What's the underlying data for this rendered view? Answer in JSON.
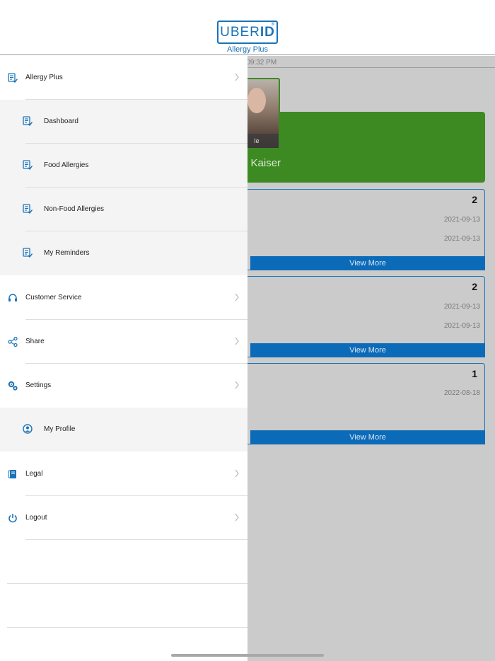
{
  "header": {
    "logo_left": "UBER",
    "logo_right": "ID",
    "logo_mark": "®",
    "subtitle": "Allergy Plus"
  },
  "background": {
    "timestamp": "3 09:32 PM",
    "photo_caption": "le",
    "name_fragment": "n Kaiser",
    "cards": [
      {
        "count": "2",
        "dates": [
          "2021-09-13",
          "2021-09-13"
        ],
        "button": "View More"
      },
      {
        "count": "2",
        "dates": [
          "2021-09-13",
          "2021-09-13"
        ],
        "button": "View More"
      },
      {
        "count": "1",
        "dates": [
          "2022-08-18"
        ],
        "button": "View More"
      }
    ],
    "colors": {
      "overlay": "#cbcbcb",
      "green": "#3d8a23",
      "blue": "#0c6bb8"
    }
  },
  "menu": {
    "items": [
      {
        "label": "Allergy Plus",
        "icon": "checklist-icon",
        "chevron": true
      },
      {
        "label": "Dashboard",
        "icon": "checklist-icon",
        "sub": true
      },
      {
        "label": "Food Allergies",
        "icon": "checklist-icon",
        "sub": true
      },
      {
        "label": "Non-Food Allergies",
        "icon": "checklist-icon",
        "sub": true
      },
      {
        "label": "My Reminders",
        "icon": "checklist-icon",
        "sub": true
      },
      {
        "label": "Customer Service",
        "icon": "headset-icon",
        "chevron": true
      },
      {
        "label": "Share",
        "icon": "share-icon",
        "chevron": true
      },
      {
        "label": "Settings",
        "icon": "gears-icon",
        "chevron": true
      },
      {
        "label": "My Profile",
        "icon": "profile-icon",
        "sub": true
      },
      {
        "label": "Legal",
        "icon": "book-icon",
        "chevron": true
      },
      {
        "label": "Logout",
        "icon": "power-icon",
        "chevron": true
      }
    ],
    "accent": "#1a73b8"
  }
}
